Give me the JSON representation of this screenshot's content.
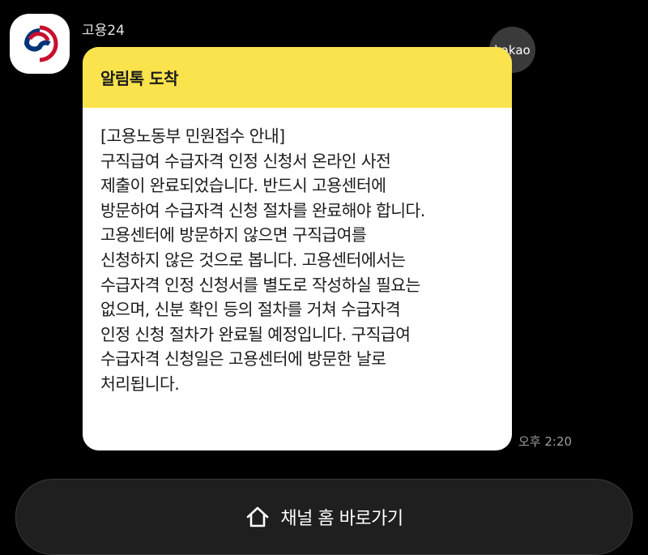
{
  "sender": {
    "name": "고용24",
    "avatar_icon": "korea-gov-emblem-icon",
    "badge": "kakao"
  },
  "message": {
    "header": "알림톡 도착",
    "lines": [
      "[고용노동부 민원접수 안내]",
      "구직급여 수급자격 인정 신청서 온라인 사전",
      "제출이 완료되었습니다. 반드시 고용센터에",
      "방문하여 수급자격 신청 절차를 완료해야 합니다.",
      "고용센터에 방문하지 않으면 구직급여를",
      "신청하지 않은 것으로 봅니다.  고용센터에서는",
      "수급자격 인정 신청서를 별도로 작성하실 필요는",
      "없으며, 신분 확인 등의 절차를 거쳐 수급자격",
      "인정 신청 절차가 완료될 예정입니다.  구직급여",
      "수급자격 신청일은 고용센터에 방문한 날로",
      "처리됩니다."
    ],
    "time": "오후 2:20"
  },
  "footer": {
    "button_label": "채널 홈 바로가기",
    "button_icon": "home-icon"
  },
  "colors": {
    "background": "#000000",
    "header_yellow": "#fae34c",
    "bubble": "#ffffff",
    "button_bg": "#1f1f1f"
  }
}
